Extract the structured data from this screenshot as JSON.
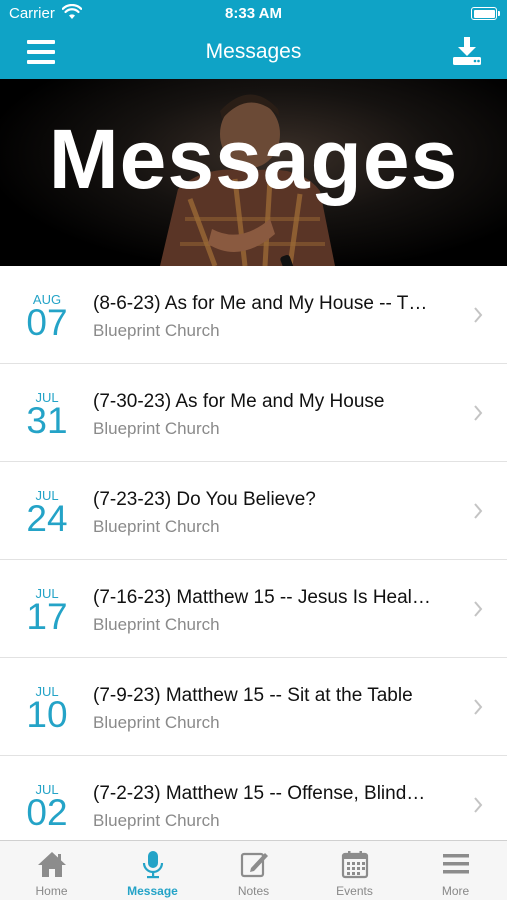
{
  "status_bar": {
    "carrier": "Carrier",
    "time": "8:33 AM"
  },
  "nav": {
    "title": "Messages",
    "menu_icon": "hamburger-menu-icon",
    "download_icon": "download-icon"
  },
  "hero": {
    "banner_text": "Messages"
  },
  "messages": [
    {
      "month": "AUG",
      "day": "07",
      "title": "(8-6-23) As for Me and My House -- T…",
      "subtitle": "Blueprint Church"
    },
    {
      "month": "JUL",
      "day": "31",
      "title": "(7-30-23) As for Me and My House",
      "subtitle": "Blueprint Church"
    },
    {
      "month": "JUL",
      "day": "24",
      "title": "(7-23-23) Do You Believe?",
      "subtitle": "Blueprint Church"
    },
    {
      "month": "JUL",
      "day": "17",
      "title": "(7-16-23) Matthew 15 -- Jesus Is Heal…",
      "subtitle": "Blueprint Church"
    },
    {
      "month": "JUL",
      "day": "10",
      "title": "(7-9-23) Matthew 15 -- Sit at the Table",
      "subtitle": "Blueprint Church"
    },
    {
      "month": "JUL",
      "day": "02",
      "title": "(7-2-23) Matthew 15 -- Offense, Blind…",
      "subtitle": "Blueprint Church"
    }
  ],
  "tabs": [
    {
      "label": "Home",
      "icon": "home-icon",
      "active": false
    },
    {
      "label": "Message",
      "icon": "microphone-icon",
      "active": true
    },
    {
      "label": "Notes",
      "icon": "notes-icon",
      "active": false
    },
    {
      "label": "Events",
      "icon": "calendar-icon",
      "active": false
    },
    {
      "label": "More",
      "icon": "more-menu-icon",
      "active": false
    }
  ],
  "colors": {
    "accent": "#0fa3c6",
    "date_text": "#24a3c7",
    "inactive_tab": "#888888"
  }
}
